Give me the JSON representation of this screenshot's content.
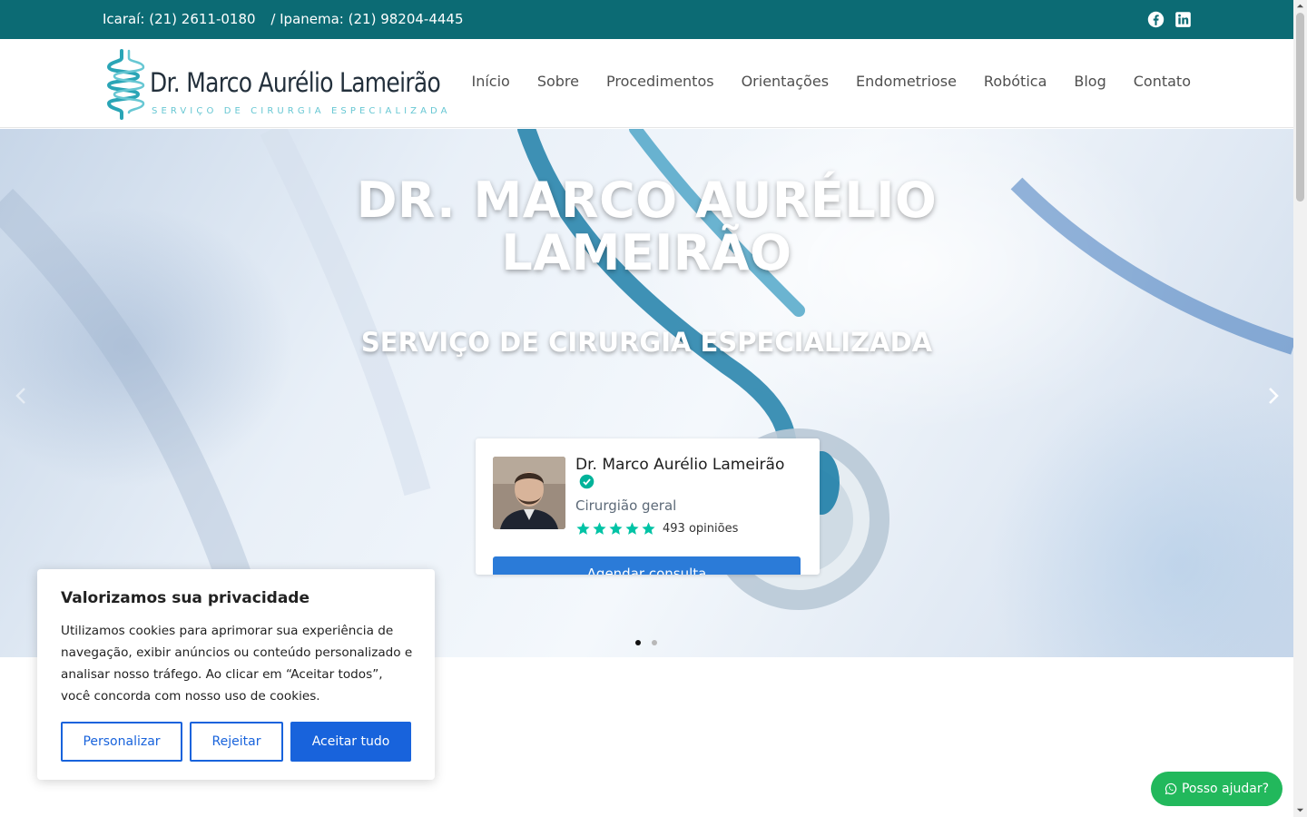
{
  "topbar": {
    "phone_icarai": "Icaraí: (21) 2611-0180",
    "phone_ipanema": "/ Ipanema: (21) 98204-4445",
    "social_icons": [
      "facebook-icon",
      "linkedin-icon"
    ]
  },
  "logo": {
    "name": "Dr. Marco Aurélio Lameirão",
    "tagline": "SERVIÇO DE CIRURGIA ESPECIALIZADA"
  },
  "nav": {
    "items": [
      "Início",
      "Sobre",
      "Procedimentos",
      "Orientações",
      "Endometriose",
      "Robótica",
      "Blog",
      "Contato"
    ]
  },
  "hero": {
    "title_line1": "DR. MARCO AURÉLIO",
    "title_line2": "LAMEIRÃO",
    "subtitle": "SERVIÇO DE CIRURGIA ESPECIALIZADA",
    "slides_total": 2,
    "active_slide": 1
  },
  "doctor_card": {
    "name": "Dr. Marco Aurélio Lameirão",
    "specialty": "Cirurgião geral",
    "rating_stars": 5,
    "reviews": "493 opiniões",
    "button": "Agendar consulta"
  },
  "cookie": {
    "title": "Valorizamos sua privacidade",
    "text": "Utilizamos cookies para aprimorar sua experiência de navegação, exibir anúncios ou conteúdo personalizado e analisar nosso tráfego. Ao clicar em “Aceitar todos”, você concorda com nosso uso de cookies.",
    "customize": "Personalizar",
    "reject": "Rejeitar",
    "accept": "Aceitar tudo"
  },
  "whatsapp": {
    "label": "Posso ajudar?"
  },
  "colors": {
    "topbar": "#0c6b74",
    "accent_teal": "#2aa5b6",
    "primary_blue": "#1863dc",
    "whatsapp_green": "#22b85c",
    "star_green": "#00c3a5"
  }
}
